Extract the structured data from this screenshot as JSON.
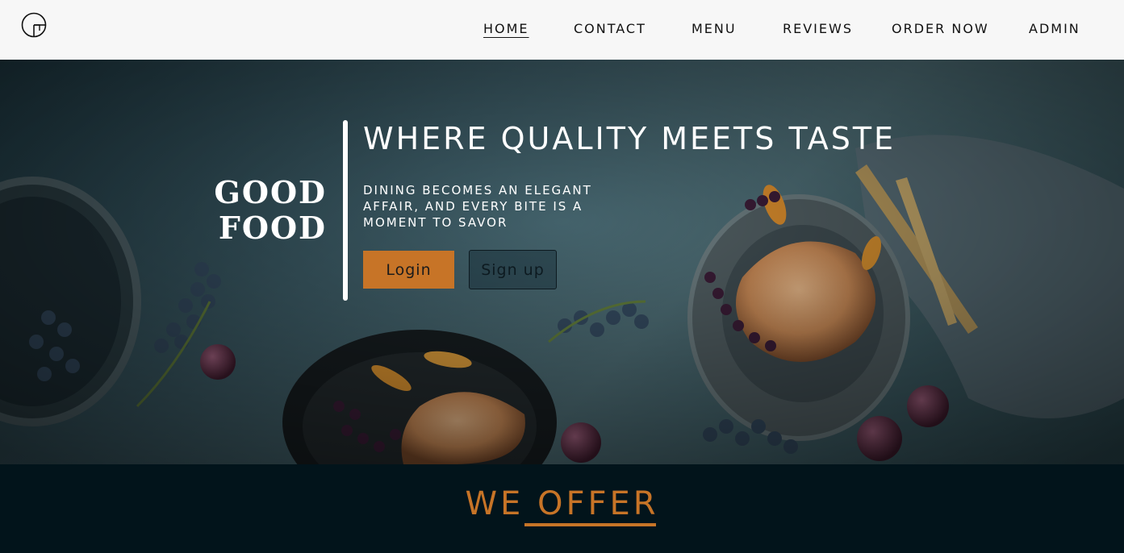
{
  "nav": {
    "logo_icon": "g-monogram-logo-icon",
    "items": [
      {
        "label": "HOME",
        "active": true
      },
      {
        "label": "CONTACT",
        "active": false
      },
      {
        "label": "MENU",
        "active": false
      },
      {
        "label": "REVIEWS",
        "active": false
      },
      {
        "label": "ORDER NOW",
        "active": false
      },
      {
        "label": "ADMIN",
        "active": false
      }
    ]
  },
  "hero": {
    "brand_line1": "GOOD",
    "brand_line2": "FOOD",
    "headline": "WHERE QUALITY MEETS TASTE",
    "subline": "DINING BECOMES AN ELEGANT AFFAIR, AND EVERY BITE IS A MOMENT TO SAVOR",
    "login_label": "Login",
    "signup_label": "Sign up"
  },
  "offer": {
    "title": "WE OFFER"
  },
  "colors": {
    "accent": "#c77427",
    "dark": "#02141b",
    "nav_bg": "#f7f7f7"
  }
}
